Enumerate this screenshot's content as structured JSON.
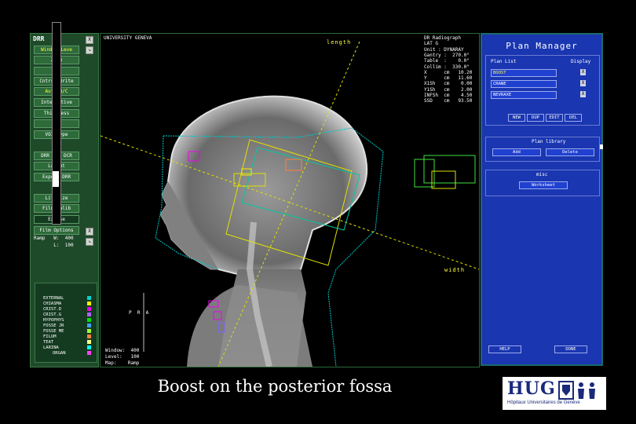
{
  "drr_panel": {
    "title": "DRR",
    "buttons": [
      "Window/Leve",
      "Zoom",
      "Pan",
      "Cntrst/Brite",
      "Auto B/C",
      "Interactive",
      "Thickness",
      "VOI",
      "VOI Type",
      "DRR <-> DCR",
      "Layout",
      "Export DRR",
      "Lifesize",
      "Film Calib",
      "Expose",
      "Film Options"
    ],
    "close_btn": "X",
    "min_btn": "↘",
    "ramp_line1": "Ramp   W:  400",
    "ramp_line2": "       L:  100"
  },
  "legend": [
    {
      "name": "EXTERNAL",
      "color": "#00d0d0"
    },
    {
      "name": "CHIASMA",
      "color": "#f0f000"
    },
    {
      "name": "CRIST.D",
      "color": "#f000f0"
    },
    {
      "name": "CRIST.G",
      "color": "#b060ff"
    },
    {
      "name": "HYPOPHYS",
      "color": "#00e000"
    },
    {
      "name": "FOSSE JR",
      "color": "#40a0ff"
    },
    {
      "name": "FOSSE ME",
      "color": "#a0ff40"
    },
    {
      "name": "FILUM",
      "color": "#ff8040"
    },
    {
      "name": "TEAT",
      "color": "#ffff80"
    },
    {
      "name": "LARINA",
      "color": "#00ffff"
    },
    {
      "name": "ORGAN",
      "color": "#ff40ff"
    }
  ],
  "viewport": {
    "institution": "UNIVERSITY GENEVA",
    "info_lines": [
      "DR Radiograph",
      "LAT G",
      "Unit : DYNARAY",
      "Gantry :  270.0°",
      "Table  :    0.0°",
      "Collim :  330.0°",
      "X      cm   10.20",
      "Y      cm   11.60",
      "X1Sh   cm    0.00",
      "Y1Sh   cm    2.00",
      "INFSh  cm    4.50",
      "SSD    cm   93.50"
    ],
    "length_label": "length",
    "width_label": "width",
    "orientation": "P  R  A",
    "window_line": "Window:  400",
    "level_line": "Level:   100",
    "map_line": "Map:    Ramp"
  },
  "plan_manager": {
    "title": "Plan Manager",
    "plan_list_label": "Plan List",
    "display_label": "Display",
    "plans": [
      "BOOST",
      "CRANE",
      "NEVRAXE"
    ],
    "x_label": "X",
    "list_buttons": [
      "NEW",
      "DUP",
      "EDIT",
      "DEL"
    ],
    "library_label": "Plan library",
    "library_buttons": [
      "Add",
      "Delete"
    ],
    "misc_label": "misc",
    "misc_button": "Worksheet",
    "help_button": "HELP",
    "done_button": "DONE"
  },
  "caption": "Boost on the posterior fossa",
  "logo": {
    "text": "HUG",
    "subtitle": "Hôpitaux Universitaires de Genève"
  },
  "colors": {
    "plan_blue": "#1a36b0",
    "drr_green": "#1f4a2a",
    "beam_yellow": "#e0e000",
    "contour_cyan": "#00c8c8"
  }
}
